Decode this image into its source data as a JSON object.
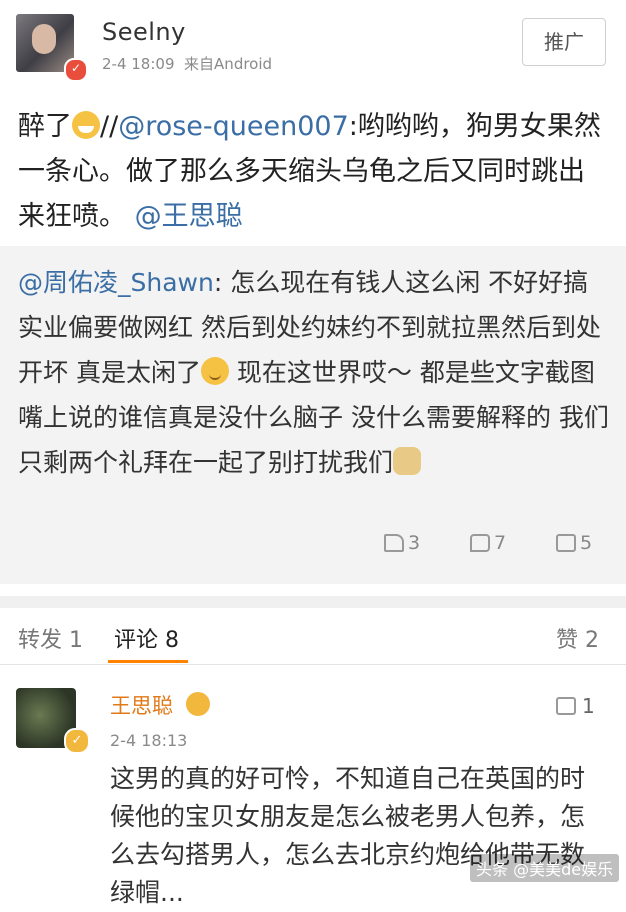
{
  "header": {
    "username": "Seelny",
    "time": "2-4 18:09",
    "source": "来自Android",
    "promote_label": "推广"
  },
  "post": {
    "prefix": "醉了",
    "sep": "//",
    "mention1": "@rose-queen007",
    "body": ":哟哟哟，狗男女果然一条心。做了那么多天缩头乌龟之后又同时跳出来狂喷。",
    "mention2": "@王思聪"
  },
  "repost": {
    "mention": "@周佑凌_Shawn",
    "text1": ": 怎么现在有钱人这么闲 不好好搞实业偏要做网红 然后到处约妹约不到就拉黑然后到处开坏  真是太闲了",
    "text2": " 现在这世界哎～ 都是些文字截图嘴上说的谁信真是没什么脑子 没什么需要解释的 我们只剩两个礼拜在一起了别打扰我们",
    "reposts": "3",
    "comments": "7",
    "likes": "5"
  },
  "tabs": {
    "repost_label": "转发",
    "repost_count": "1",
    "comment_label": "评论",
    "comment_count": "8",
    "like_label": "赞",
    "like_count": "2"
  },
  "comment": {
    "name": "王思聪",
    "time": "2-4 18:13",
    "likes": "1",
    "text": "这男的真的好可怜，不知道自己在英国的时候他的宝贝女朋友是怎么被老男人包养，怎么去勾搭男人，怎么去北京约炮给他带无数绿帽..."
  },
  "watermark": "头条 @美美de娱乐"
}
